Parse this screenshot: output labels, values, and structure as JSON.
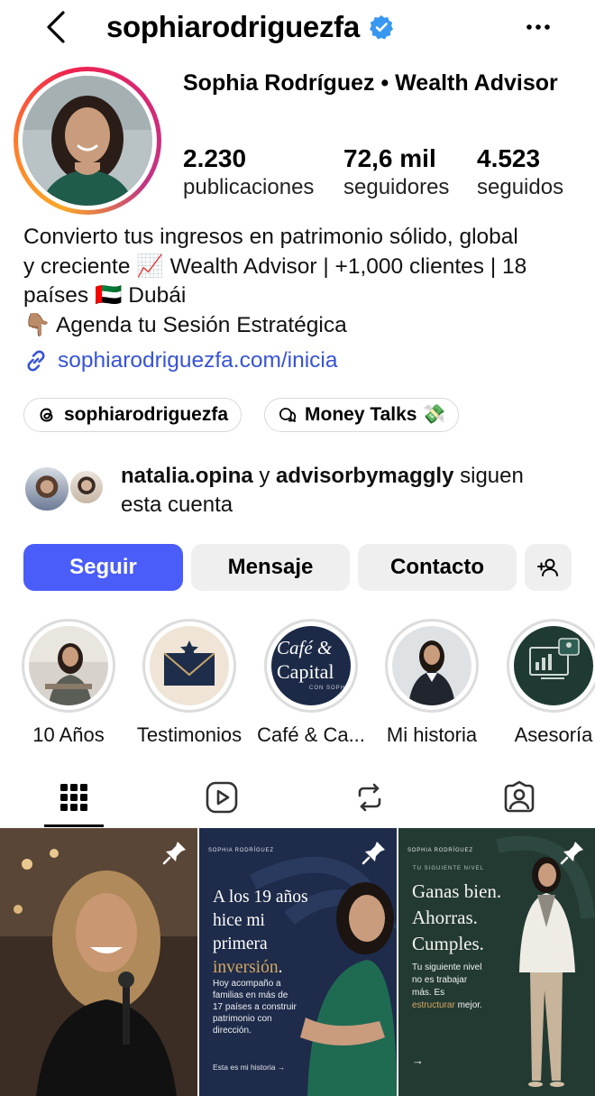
{
  "header": {
    "username": "sophiarodriguezfa",
    "verified": true,
    "icons": [
      "chevron-left-icon",
      "verified-badge-icon",
      "more-icon"
    ]
  },
  "profile": {
    "display_name": "Sophia Rodríguez • Wealth Advisor",
    "stats": [
      {
        "value": "2.230",
        "label": "publicaciones"
      },
      {
        "value": "72,6 mil",
        "label": "seguidores"
      },
      {
        "value": "4.523",
        "label": "seguidos"
      }
    ],
    "bio_lines": [
      "Convierto tus ingresos en patrimonio sólido, global",
      "y creciente 📈 Wealth Advisor | +1,000 clientes | 18",
      "países 🇦🇪 Dubái",
      "👇🏽 Agenda tu Sesión Estratégica"
    ],
    "link": "sophiarodriguezfa.com/inicia",
    "chips": [
      {
        "label": "sophiarodriguezfa",
        "icon": "threads-icon"
      },
      {
        "label": "Money Talks 💸",
        "icon": "broadcast-chat-icon"
      }
    ]
  },
  "followed_by": {
    "user1": "natalia.opina",
    "connector": " y ",
    "user2": "advisorbymaggly",
    "suffix_same_line": " siguen",
    "suffix_next_line": "esta cuenta"
  },
  "actions": {
    "follow": "Seguir",
    "message": "Mensaje",
    "contact": "Contacto",
    "add_user_icon": "add-person-icon"
  },
  "highlights": [
    {
      "label": "10 Años"
    },
    {
      "label": "Testimonios"
    },
    {
      "label": "Café & Ca...",
      "cover_text_1": "Café &",
      "cover_text_2": "Capital",
      "cover_text_3": "CON SOPH"
    },
    {
      "label": "Mi historia"
    },
    {
      "label": "Asesoría"
    }
  ],
  "tabs": [
    "grid-icon",
    "reels-icon",
    "reposts-icon",
    "tagged-icon"
  ],
  "posts": [
    {
      "pinned": true
    },
    {
      "pinned": true,
      "brand": "SOPHIA RODRÍGUEZ",
      "headline_1": "A los 19 años",
      "headline_2": "hice mi",
      "headline_3": "primera",
      "headline_4": "inversión",
      "headline_4_end": ".",
      "body_1": "Hoy acompaño a",
      "body_2": "familias en más de",
      "body_3": "17 países a construir",
      "body_4": "patrimonio con",
      "body_5": "dirección.",
      "cta": "Esta es mi historia →"
    },
    {
      "pinned": true,
      "brand": "SOPHIA RODRÍGUEZ",
      "kicker": "TU SIGUIENTE NIVEL",
      "headline_1": "Ganas bien.",
      "headline_2": "Ahorras.",
      "headline_3": "Cumples.",
      "body_1": "Tu siguiente nivel",
      "body_2": "no es trabajar",
      "body_3": "más. Es",
      "body_4": "estructurar",
      "body_4_end": " mejor.",
      "arrow": "→"
    }
  ],
  "colors": {
    "accent": "#4a5df9",
    "link": "#3753d6",
    "verified": "#3897f0",
    "post2_bg": "#1e2b4a",
    "post3_bg": "#233a32",
    "highlight_gold": "#c8a46a"
  }
}
